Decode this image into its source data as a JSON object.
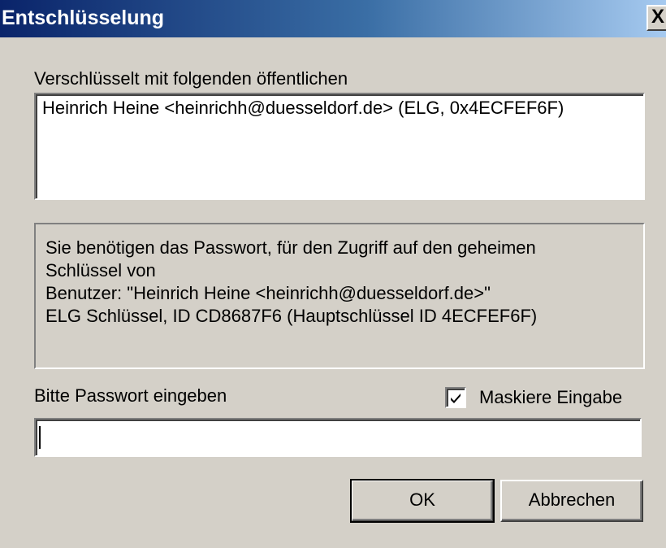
{
  "window": {
    "title": "Entschlüsselung",
    "close_label": "X"
  },
  "recipients": {
    "label": "Verschlüsselt mit folgenden öffentlichen",
    "items": [
      "Heinrich Heine <heinrichh@duesseldorf.de> (ELG, 0x4ECFEF6F)"
    ]
  },
  "info": {
    "lines": [
      "Sie benötigen das Passwort, für den Zugriff auf den geheimen",
      "Schlüssel von",
      "Benutzer: \"Heinrich Heine <heinrichh@duesseldorf.de>\"",
      "ELG Schlüssel, ID CD8687F6 (Hauptschlüssel ID 4ECFEF6F)"
    ]
  },
  "password": {
    "label": "Bitte Passwort eingeben",
    "value": "",
    "mask_label": "Maskiere Eingabe",
    "mask_checked": true
  },
  "buttons": {
    "ok": "OK",
    "cancel": "Abbrechen"
  }
}
